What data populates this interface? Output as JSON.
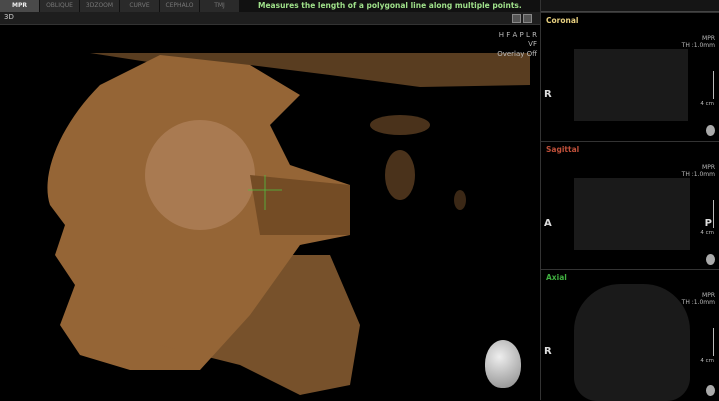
{
  "tabs": [
    {
      "label": "MPR",
      "active": true
    },
    {
      "label": "OBLIQUE"
    },
    {
      "label": "3DZOOM"
    },
    {
      "label": "CURVE"
    },
    {
      "label": "CEPHALO"
    },
    {
      "label": "TMJ"
    }
  ],
  "hint": "Measures the length of a polygonal line along multiple points.",
  "view3d": {
    "title": "3D",
    "overlay": [
      "H F A P L R",
      "VF",
      "Overlay Off"
    ],
    "render_color": "#c08850"
  },
  "panels": [
    {
      "title": "Coronal",
      "color": "#e8d080",
      "mode": "MPR",
      "thickness": "TH :1.0mm",
      "orientation": "R",
      "scale": "4 cm"
    },
    {
      "title": "Sagittal",
      "color": "#c0503a",
      "mode": "MPR",
      "thickness": "TH :1.0mm",
      "orientation": "A",
      "orientation_right": "P",
      "scale": "4 cm"
    },
    {
      "title": "Axial",
      "color": "#40b040",
      "mode": "MPR",
      "thickness": "TH :1.0mm",
      "orientation": "R",
      "scale": "4 cm"
    }
  ]
}
